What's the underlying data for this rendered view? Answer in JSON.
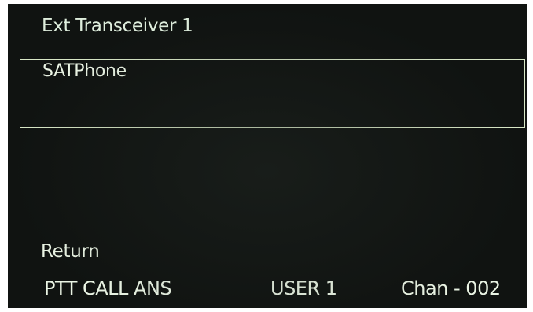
{
  "screen": {
    "title": "Ext Transceiver 1",
    "menu": {
      "items": [
        {
          "label": "SATPhone",
          "selected": true
        }
      ]
    },
    "return_label": "Return",
    "status_bar": {
      "left": "PTT CALL ANS",
      "center": "USER 1",
      "right": "Chan -  002"
    }
  }
}
